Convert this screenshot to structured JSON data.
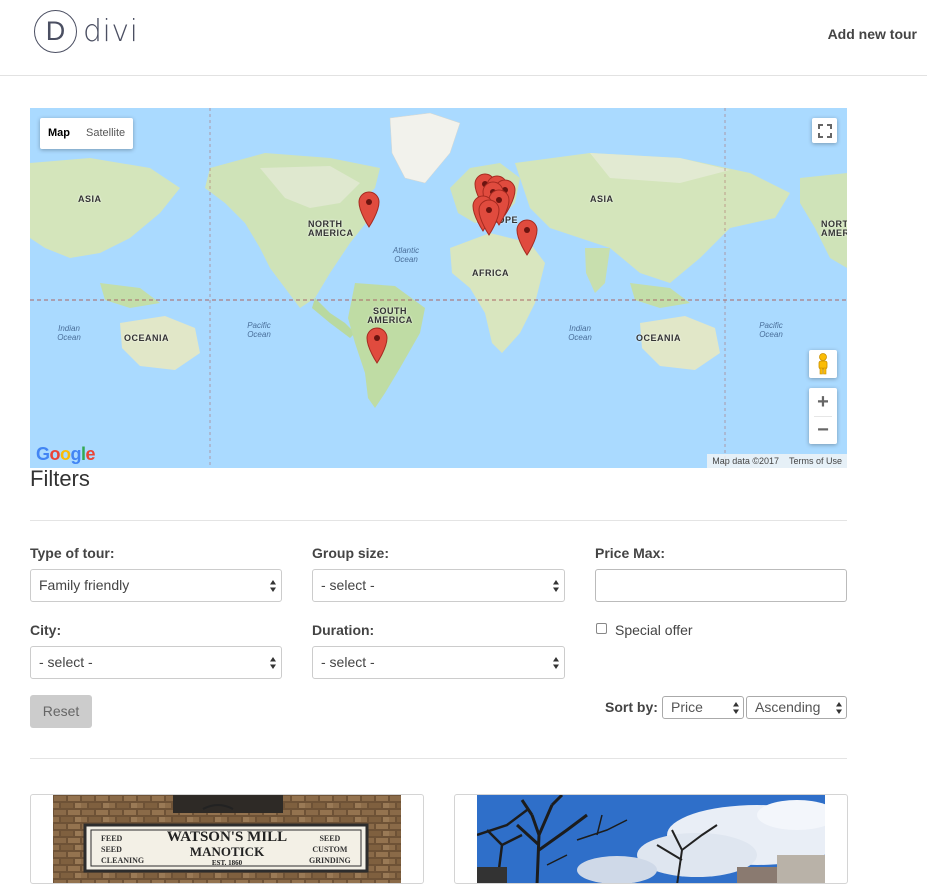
{
  "header": {
    "logo_letter": "D",
    "logo_text": "divi",
    "nav_link": "Add new tour"
  },
  "map": {
    "type_controls": [
      "Map",
      "Satellite"
    ],
    "active_type": "Map",
    "continent_labels": {
      "asia_left": "ASIA",
      "north_america": "NORTH AMERICA",
      "europe": "EUROPE",
      "asia_right": "ASIA",
      "north_america_right": "NORTH AMERIC",
      "africa": "AFRICA",
      "south_america": "SOUTH AMERICA",
      "oceania_left": "OCEANIA",
      "oceania_right": "OCEANIA"
    },
    "ocean_labels": {
      "atlantic": "Atlantic Ocean",
      "pacific_left": "Pacific Ocean",
      "indian_left": "Indian Ocean",
      "indian_right": "Indian Ocean",
      "pacific_right": "Pacific Ocean"
    },
    "google_logo": [
      "G",
      "o",
      "o",
      "g",
      "l",
      "e"
    ],
    "map_data": "Map data ©2017",
    "terms": "Terms of Use",
    "zoom_in": "+",
    "zoom_out": "−",
    "marker_color": "#e04b3e"
  },
  "filters": {
    "title": "Filters",
    "type_of_tour": {
      "label": "Type of tour:",
      "value": "Family friendly"
    },
    "group_size": {
      "label": "Group size:",
      "value": "- select -"
    },
    "price_max": {
      "label": "Price Max:",
      "value": ""
    },
    "city": {
      "label": "City:",
      "value": "- select -"
    },
    "duration": {
      "label": "Duration:",
      "value": "- select -"
    },
    "special_offer": {
      "label": "Special offer",
      "checked": false
    },
    "reset_label": "Reset",
    "sort": {
      "label": "Sort by:",
      "field": "Price",
      "order": "Ascending"
    }
  },
  "cards": [
    {
      "sign_line1_left": "FEED",
      "sign_title": "WATSON'S MILL",
      "sign_line1_right": "SEED",
      "sign_line2_left": "SEED",
      "sign_subtitle": "MANOTICK",
      "sign_line2_right": "CUSTOM",
      "sign_line3_left": "CLEANING",
      "sign_est": "EST. 1860",
      "sign_line3_right": "GRINDING"
    },
    {
      "image": "trees-and-sky"
    }
  ]
}
